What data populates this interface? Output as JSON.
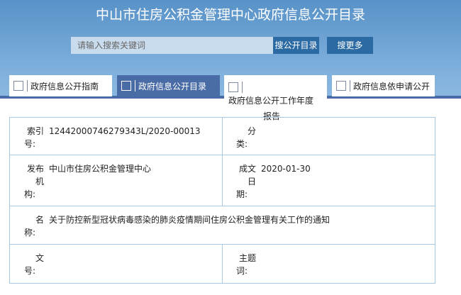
{
  "header": {
    "title": "中山市住房公积金管理中心政府信息公开目录",
    "search_placeholder": "请输入搜索关键词",
    "search_button": "搜公开目录",
    "more_button": "搜更多"
  },
  "tabs": [
    {
      "label": "政府信息公开指南",
      "icon": "document-icon"
    },
    {
      "label": "政府信息公开目录",
      "icon": "catalog-icon",
      "active": true
    },
    {
      "label": "政府信息公开工作年度报告",
      "icon": "report-icon"
    },
    {
      "label": "政府信息依申请公开",
      "icon": "application-icon"
    }
  ],
  "meta": {
    "index_label": "索引号:",
    "index_value": "12442000746279343L/2020-00013",
    "category_label": "分类:",
    "category_value": "",
    "publisher_label": "发布机构:",
    "publisher_value": "中山市住房公积金管理中心",
    "date_label": "成文日期:",
    "date_value": "2020-01-30",
    "name_label": "名称:",
    "name_value": "关于防控新型冠状病毒感染的肺炎疫情期间住房公积金管理有关工作的通知",
    "doc_no_label": "文号:",
    "doc_no_value": "",
    "keywords_label": "主题词:",
    "keywords_value": ""
  }
}
